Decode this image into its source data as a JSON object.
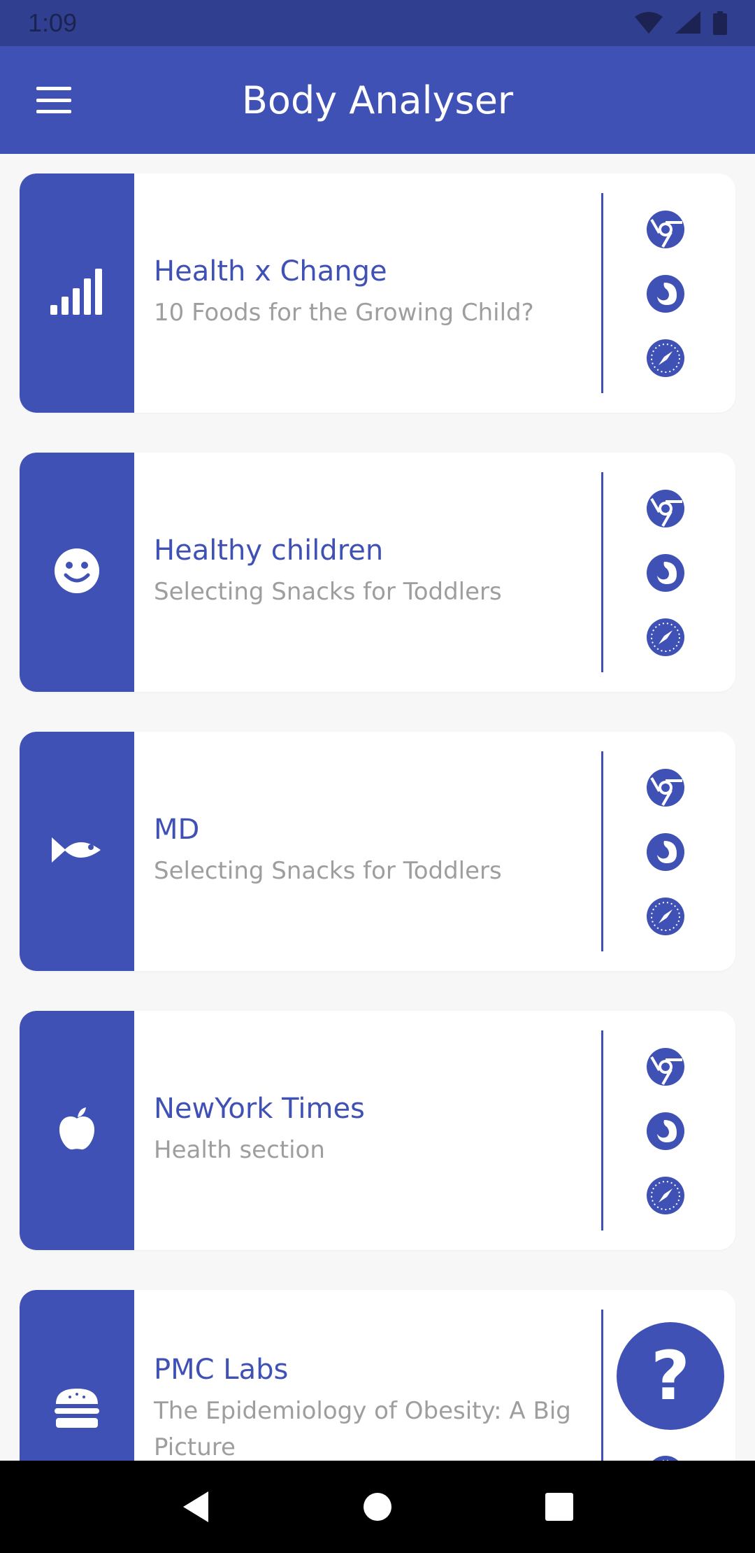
{
  "status_bar": {
    "time": "1:09"
  },
  "app_bar": {
    "title": "Body Analyser"
  },
  "colors": {
    "primary": "#3f51b5",
    "primary_dark": "#303f8f",
    "subtitle_gray": "#9e9e9e"
  },
  "cards": [
    {
      "icon": "signal-bars-icon",
      "title": "Health x Change",
      "subtitle": "10 Foods for the Growing Child?"
    },
    {
      "icon": "smiley-icon",
      "title": "Healthy children",
      "subtitle": "Selecting Snacks for Toddlers"
    },
    {
      "icon": "fish-icon",
      "title": " MD",
      "subtitle": "Selecting Snacks for Toddlers"
    },
    {
      "icon": "apple-icon",
      "title": "NewYork Times",
      "subtitle": "Health section"
    },
    {
      "icon": "hamburger-food-icon",
      "title": "PMC Labs",
      "subtitle": "The Epidemiology of Obesity: A Big Picture"
    }
  ],
  "browser_icons": [
    "chrome-icon",
    "firefox-icon",
    "safari-icon"
  ],
  "fab": {
    "label": "?"
  }
}
